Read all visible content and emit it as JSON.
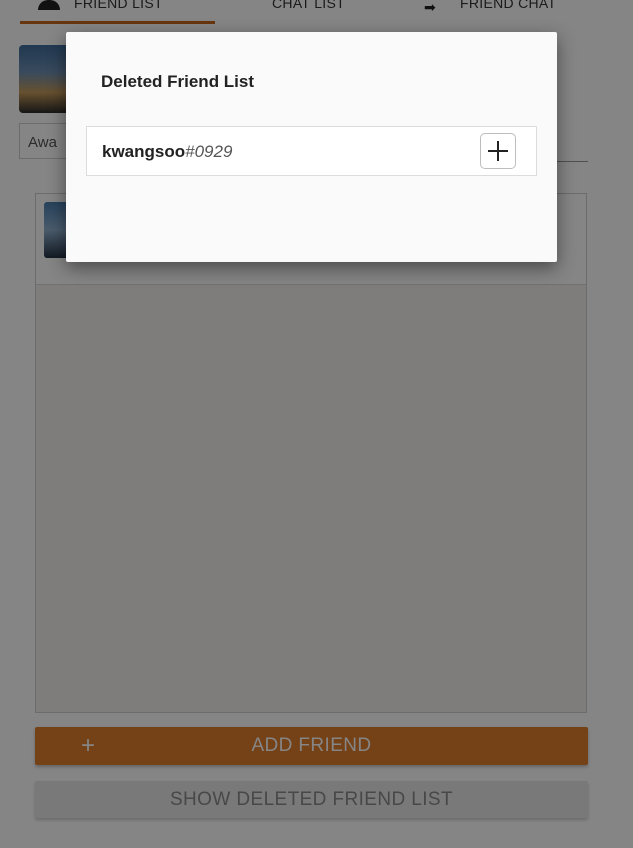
{
  "tabs": [
    {
      "label": "FRIEND LIST",
      "icon": "person-icon",
      "active": true
    },
    {
      "label": "CHAT LIST",
      "icon": "chat-list-icon",
      "active": false
    },
    {
      "label": "FRIEND CHAT",
      "icon": "arrow-icon",
      "active": false
    }
  ],
  "profile": {
    "status_text": "Awa"
  },
  "buttons": {
    "add_friend_plus": "+",
    "add_friend": "ADD FRIEND",
    "show_deleted": "SHOW DELETED FRIEND LIST"
  },
  "dialog": {
    "title": "Deleted Friend List",
    "items": [
      {
        "name": "kwangsoo",
        "tag": "#0929"
      }
    ]
  },
  "colors": {
    "accent": "#e17e2b",
    "tab_underline": "#c8691b"
  }
}
